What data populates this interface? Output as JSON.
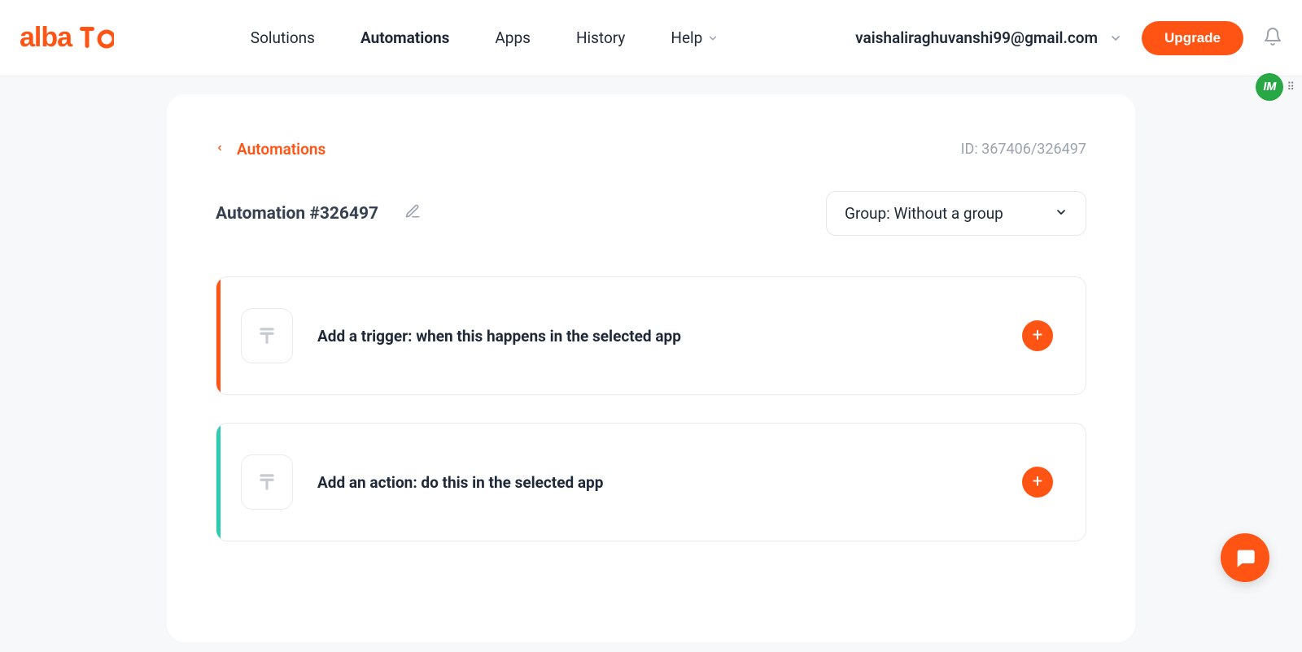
{
  "brand": {
    "name": "albato"
  },
  "nav": {
    "solutions": "Solutions",
    "automations": "Automations",
    "apps": "Apps",
    "history": "History",
    "help": "Help"
  },
  "user": {
    "email": "vaishaliraghuvanshi99@gmail.com",
    "upgrade_label": "Upgrade"
  },
  "breadcrumb": {
    "back_label": "Automations"
  },
  "page": {
    "id_label": "ID: 367406/326497",
    "title": "Automation #326497",
    "group_label": "Group: Without a group"
  },
  "steps": {
    "trigger_text": "Add a trigger: when this happens in the selected app",
    "action_text": "Add an action: do this in the selected app"
  },
  "widgets": {
    "green_badge_text": "IM"
  }
}
